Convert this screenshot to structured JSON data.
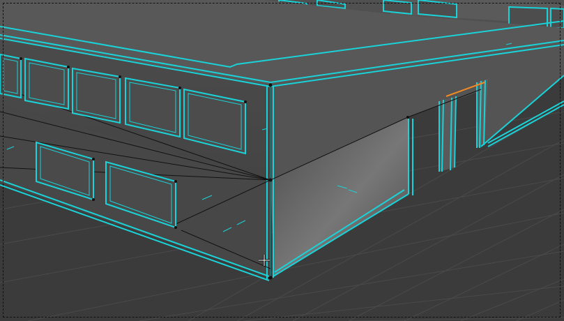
{
  "viewport": {
    "name": "3d-viewport",
    "background": "#3b3b3b",
    "grid_color": "#4a4a4a",
    "mesh_fill_top": "#5a5a5a",
    "mesh_fill_side": "#4f4f4f",
    "wire_color": "#19d3d8",
    "edge_color": "#111111",
    "selected_edge_color": "#f08a24"
  },
  "cursor": {
    "icon": "crosshair-cursor-icon"
  }
}
